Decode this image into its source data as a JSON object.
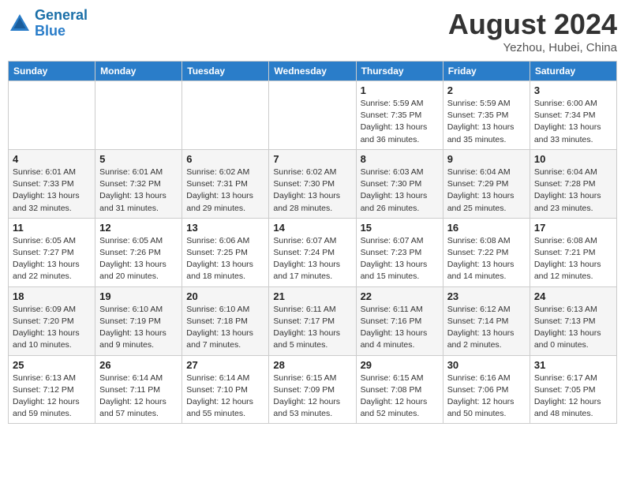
{
  "header": {
    "logo_line1": "General",
    "logo_line2": "Blue",
    "month_year": "August 2024",
    "location": "Yezhou, Hubei, China"
  },
  "days_of_week": [
    "Sunday",
    "Monday",
    "Tuesday",
    "Wednesday",
    "Thursday",
    "Friday",
    "Saturday"
  ],
  "weeks": [
    [
      {
        "day": "",
        "info": ""
      },
      {
        "day": "",
        "info": ""
      },
      {
        "day": "",
        "info": ""
      },
      {
        "day": "",
        "info": ""
      },
      {
        "day": "1",
        "info": "Sunrise: 5:59 AM\nSunset: 7:35 PM\nDaylight: 13 hours\nand 36 minutes."
      },
      {
        "day": "2",
        "info": "Sunrise: 5:59 AM\nSunset: 7:35 PM\nDaylight: 13 hours\nand 35 minutes."
      },
      {
        "day": "3",
        "info": "Sunrise: 6:00 AM\nSunset: 7:34 PM\nDaylight: 13 hours\nand 33 minutes."
      }
    ],
    [
      {
        "day": "4",
        "info": "Sunrise: 6:01 AM\nSunset: 7:33 PM\nDaylight: 13 hours\nand 32 minutes."
      },
      {
        "day": "5",
        "info": "Sunrise: 6:01 AM\nSunset: 7:32 PM\nDaylight: 13 hours\nand 31 minutes."
      },
      {
        "day": "6",
        "info": "Sunrise: 6:02 AM\nSunset: 7:31 PM\nDaylight: 13 hours\nand 29 minutes."
      },
      {
        "day": "7",
        "info": "Sunrise: 6:02 AM\nSunset: 7:30 PM\nDaylight: 13 hours\nand 28 minutes."
      },
      {
        "day": "8",
        "info": "Sunrise: 6:03 AM\nSunset: 7:30 PM\nDaylight: 13 hours\nand 26 minutes."
      },
      {
        "day": "9",
        "info": "Sunrise: 6:04 AM\nSunset: 7:29 PM\nDaylight: 13 hours\nand 25 minutes."
      },
      {
        "day": "10",
        "info": "Sunrise: 6:04 AM\nSunset: 7:28 PM\nDaylight: 13 hours\nand 23 minutes."
      }
    ],
    [
      {
        "day": "11",
        "info": "Sunrise: 6:05 AM\nSunset: 7:27 PM\nDaylight: 13 hours\nand 22 minutes."
      },
      {
        "day": "12",
        "info": "Sunrise: 6:05 AM\nSunset: 7:26 PM\nDaylight: 13 hours\nand 20 minutes."
      },
      {
        "day": "13",
        "info": "Sunrise: 6:06 AM\nSunset: 7:25 PM\nDaylight: 13 hours\nand 18 minutes."
      },
      {
        "day": "14",
        "info": "Sunrise: 6:07 AM\nSunset: 7:24 PM\nDaylight: 13 hours\nand 17 minutes."
      },
      {
        "day": "15",
        "info": "Sunrise: 6:07 AM\nSunset: 7:23 PM\nDaylight: 13 hours\nand 15 minutes."
      },
      {
        "day": "16",
        "info": "Sunrise: 6:08 AM\nSunset: 7:22 PM\nDaylight: 13 hours\nand 14 minutes."
      },
      {
        "day": "17",
        "info": "Sunrise: 6:08 AM\nSunset: 7:21 PM\nDaylight: 13 hours\nand 12 minutes."
      }
    ],
    [
      {
        "day": "18",
        "info": "Sunrise: 6:09 AM\nSunset: 7:20 PM\nDaylight: 13 hours\nand 10 minutes."
      },
      {
        "day": "19",
        "info": "Sunrise: 6:10 AM\nSunset: 7:19 PM\nDaylight: 13 hours\nand 9 minutes."
      },
      {
        "day": "20",
        "info": "Sunrise: 6:10 AM\nSunset: 7:18 PM\nDaylight: 13 hours\nand 7 minutes."
      },
      {
        "day": "21",
        "info": "Sunrise: 6:11 AM\nSunset: 7:17 PM\nDaylight: 13 hours\nand 5 minutes."
      },
      {
        "day": "22",
        "info": "Sunrise: 6:11 AM\nSunset: 7:16 PM\nDaylight: 13 hours\nand 4 minutes."
      },
      {
        "day": "23",
        "info": "Sunrise: 6:12 AM\nSunset: 7:14 PM\nDaylight: 13 hours\nand 2 minutes."
      },
      {
        "day": "24",
        "info": "Sunrise: 6:13 AM\nSunset: 7:13 PM\nDaylight: 13 hours\nand 0 minutes."
      }
    ],
    [
      {
        "day": "25",
        "info": "Sunrise: 6:13 AM\nSunset: 7:12 PM\nDaylight: 12 hours\nand 59 minutes."
      },
      {
        "day": "26",
        "info": "Sunrise: 6:14 AM\nSunset: 7:11 PM\nDaylight: 12 hours\nand 57 minutes."
      },
      {
        "day": "27",
        "info": "Sunrise: 6:14 AM\nSunset: 7:10 PM\nDaylight: 12 hours\nand 55 minutes."
      },
      {
        "day": "28",
        "info": "Sunrise: 6:15 AM\nSunset: 7:09 PM\nDaylight: 12 hours\nand 53 minutes."
      },
      {
        "day": "29",
        "info": "Sunrise: 6:15 AM\nSunset: 7:08 PM\nDaylight: 12 hours\nand 52 minutes."
      },
      {
        "day": "30",
        "info": "Sunrise: 6:16 AM\nSunset: 7:06 PM\nDaylight: 12 hours\nand 50 minutes."
      },
      {
        "day": "31",
        "info": "Sunrise: 6:17 AM\nSunset: 7:05 PM\nDaylight: 12 hours\nand 48 minutes."
      }
    ]
  ]
}
